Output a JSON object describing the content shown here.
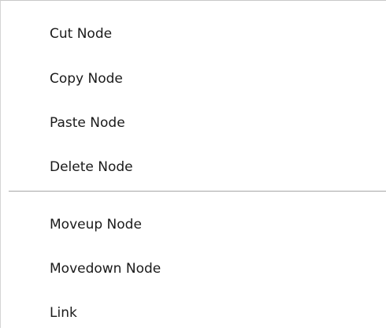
{
  "context_menu": {
    "group1": [
      {
        "label": "Cut Node"
      },
      {
        "label": "Copy Node"
      },
      {
        "label": "Paste Node"
      },
      {
        "label": "Delete Node"
      }
    ],
    "group2": [
      {
        "label": "Moveup Node"
      },
      {
        "label": "Movedown Node"
      },
      {
        "label": "Link"
      }
    ]
  }
}
